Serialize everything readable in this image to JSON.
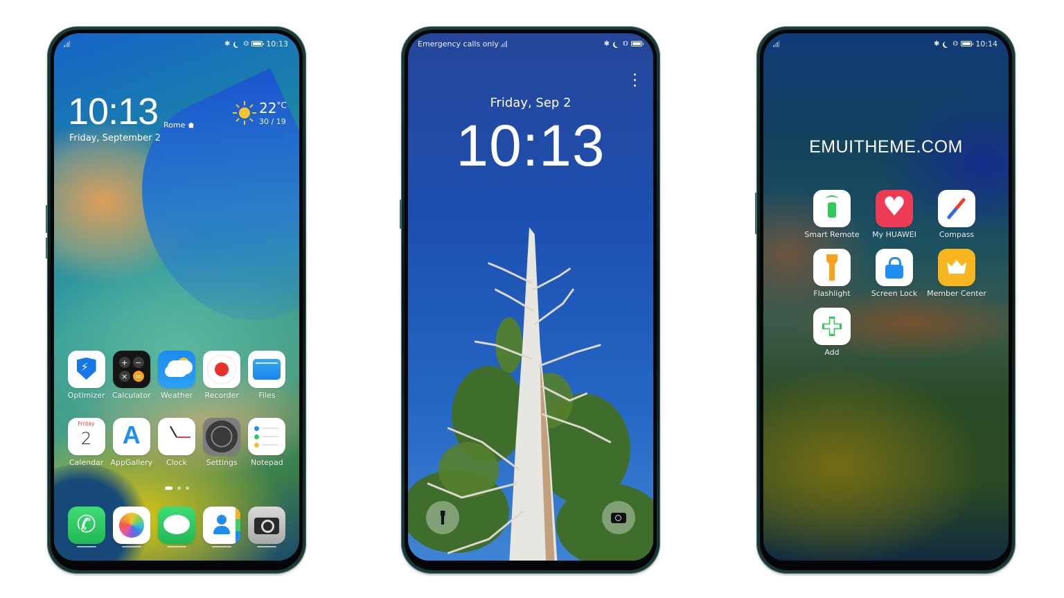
{
  "status_icons": [
    "bluetooth-icon",
    "moon-icon",
    "vibrate-icon",
    "battery-icon"
  ],
  "phone1": {
    "status": {
      "time": "10:13"
    },
    "clock_widget": {
      "time": "10:13",
      "city": "Rome",
      "date": "Friday, September 2"
    },
    "weather_widget": {
      "temp": "22",
      "unit": "°C",
      "hilo": "30 / 19",
      "condition": "sunny"
    },
    "apps_row1": [
      {
        "label": "Optimizer",
        "icon": "optimizer-icon"
      },
      {
        "label": "Calculator",
        "icon": "calculator-icon"
      },
      {
        "label": "Weather",
        "icon": "weather-icon"
      },
      {
        "label": "Recorder",
        "icon": "recorder-icon"
      },
      {
        "label": "Files",
        "icon": "files-icon"
      }
    ],
    "apps_row2": [
      {
        "label": "Calendar",
        "icon": "calendar-icon",
        "day": "Friday",
        "date": "2"
      },
      {
        "label": "AppGallery",
        "icon": "appgallery-icon"
      },
      {
        "label": "Clock",
        "icon": "clock-icon"
      },
      {
        "label": "Settings",
        "icon": "settings-icon"
      },
      {
        "label": "Notepad",
        "icon": "notepad-icon"
      }
    ],
    "page_indicator": {
      "current": 1,
      "total": 3
    },
    "dock": [
      {
        "name": "Phone",
        "icon": "phone-icon"
      },
      {
        "name": "Gallery",
        "icon": "photos-icon"
      },
      {
        "name": "Messages",
        "icon": "messages-icon"
      },
      {
        "name": "Contacts",
        "icon": "contacts-icon"
      },
      {
        "name": "Camera",
        "icon": "camera-icon"
      }
    ],
    "calc_keys": [
      "+",
      "−",
      "×",
      "="
    ]
  },
  "phone2": {
    "status": {
      "carrier": "Emergency calls only"
    },
    "date": "Friday,  Sep 2",
    "time": "10:13",
    "shortcuts": {
      "left": "flashlight-icon",
      "right": "camera-icon"
    }
  },
  "phone3": {
    "status": {
      "time": "10:14"
    },
    "brand": "EMUITHEME.COM",
    "folder_apps": [
      {
        "label": "Smart Remote",
        "icon": "smart-remote-icon"
      },
      {
        "label": "My HUAWEI",
        "icon": "my-huawei-icon"
      },
      {
        "label": "Compass",
        "icon": "compass-icon"
      },
      {
        "label": "Flashlight",
        "icon": "flashlight-icon"
      },
      {
        "label": "Screen Lock",
        "icon": "screen-lock-icon"
      },
      {
        "label": "Member Center",
        "icon": "member-center-icon"
      },
      {
        "label": "Add",
        "icon": "add-icon"
      }
    ]
  },
  "colors": {
    "sun": "#f6c52e",
    "accent_blue": "#1f8ef0",
    "accent_green": "#2fc95c",
    "lockscreen_sky": "#1d4fb0"
  }
}
